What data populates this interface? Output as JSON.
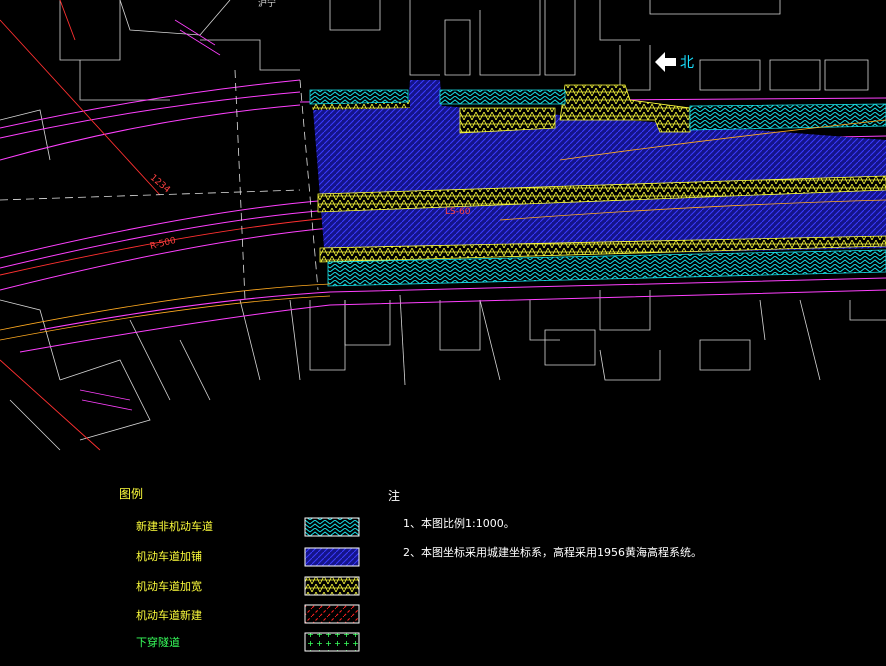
{
  "legend": {
    "title": "图例",
    "items": [
      {
        "label": "新建非机动车道",
        "color": "#18e0e8"
      },
      {
        "label": "机动车道加铺",
        "color": "#1a1ad0"
      },
      {
        "label": "机动车道加宽",
        "color": "#ffff3c"
      },
      {
        "label": "机动车道新建",
        "color": "#ff2020"
      },
      {
        "label": "下穿隧道",
        "color": "#37ff5c"
      }
    ]
  },
  "notes": {
    "title": "注",
    "items": [
      "1、本图比例1:1000。",
      "2、本图坐标采用城建坐标系，高程采用1956黄海高程系统。"
    ]
  },
  "map": {
    "north_label": "北",
    "labels": {
      "curve_r": "R-500",
      "curve_ls": "LS-60",
      "road_top_left": "沪宁",
      "bridge": "1234"
    }
  }
}
